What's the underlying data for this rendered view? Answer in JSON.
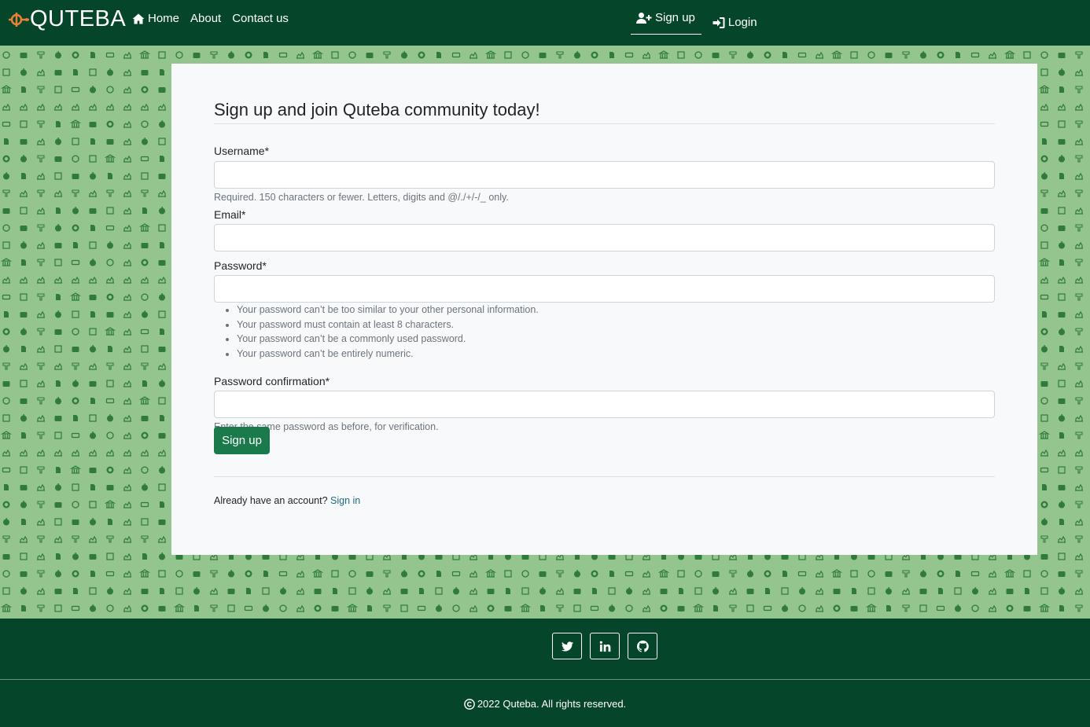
{
  "navbar": {
    "brand": "QUTEBA",
    "home": "Home",
    "about": "About",
    "contact": "Contact us",
    "signup": "Sign up",
    "login": "Login"
  },
  "form": {
    "title": "Sign up and join Quteba community today!",
    "username_label": "Username*",
    "username_help": "Required. 150 characters or fewer. Letters, digits and @/./+/-/_ only.",
    "email_label": "Email*",
    "password_label": "Password*",
    "password_rules": [
      "Your password can’t be too similar to your other personal information.",
      "Your password must contain at least 8 characters.",
      "Your password can’t be a commonly used password.",
      "Your password can’t be entirely numeric."
    ],
    "password2_label": "Password confirmation*",
    "password2_help": "Enter the same password as before, for verification.",
    "submit_label": "Sign up",
    "account_prompt": "Already have an account?",
    "signin_link": "Sign in"
  },
  "footer": {
    "copyright": "2022 Quteba. All rights reserved."
  },
  "colors": {
    "primary_dark": "#05462a",
    "pattern_bg": "#94c58f",
    "pattern_icon": "#2f7a3c",
    "button": "#1b7a4c",
    "link": "#1d6b83",
    "brand_accent": "#e8803a"
  }
}
